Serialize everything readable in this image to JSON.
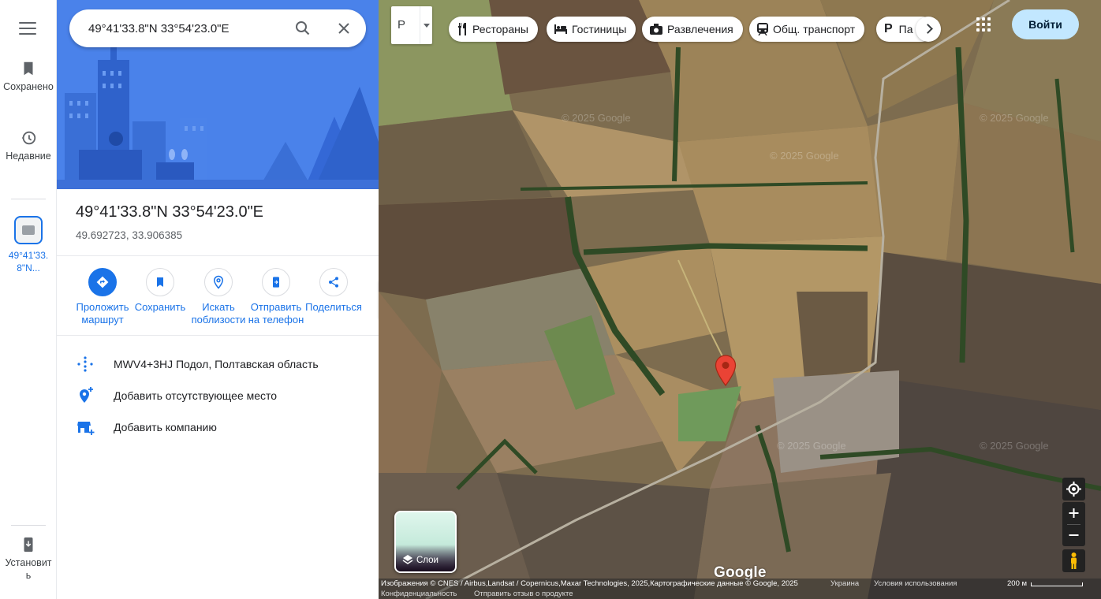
{
  "rail": {
    "items": [
      {
        "label": "Сохранено",
        "icon": "bookmark-icon"
      },
      {
        "label": "Недавние",
        "icon": "history-icon"
      },
      {
        "label": "49°41'33.8\"N..."
      },
      {
        "label": "Установить",
        "icon": "phone-install-icon"
      }
    ]
  },
  "search": {
    "value": "49°41'33.8\"N 33°54'23.0\"E"
  },
  "place": {
    "title": "49°41'33.8\"N 33°54'23.0\"E",
    "coords": "49.692723, 33.906385"
  },
  "actions": [
    {
      "label": "Проложить маршрут",
      "icon": "directions-icon"
    },
    {
      "label": "Сохранить",
      "icon": "bookmark-icon"
    },
    {
      "label": "Искать поблизости",
      "icon": "nearby-search-icon"
    },
    {
      "label": "Отправить на телефон",
      "icon": "send-to-phone-icon"
    },
    {
      "label": "Поделиться",
      "icon": "share-icon"
    }
  ],
  "info": [
    {
      "text": "MWV4+3HJ Подол, Полтавская область",
      "icon": "plus-code-icon"
    },
    {
      "text": "Добавить отсутствующее место",
      "icon": "add-place-icon"
    },
    {
      "text": "Добавить компанию",
      "icon": "add-business-icon"
    }
  ],
  "map": {
    "maptype_label": "Р",
    "chips": [
      {
        "label": "Рестораны",
        "icon": "restaurant-icon"
      },
      {
        "label": "Гостиницы",
        "icon": "hotel-icon"
      },
      {
        "label": "Развлечения",
        "icon": "camera-icon"
      },
      {
        "label": "Общ. транспорт",
        "icon": "transit-icon"
      },
      {
        "label": "Па",
        "icon": "parking-icon"
      }
    ],
    "signin_label": "Войти",
    "layers_label": "Слои",
    "watermark": "© 2025 Google",
    "logo": "Google",
    "footer": {
      "attribution": "Изображения © CNES / Airbus,Landsat / Copernicus,Maxar Technologies, 2025,Картографические данные © Google, 2025",
      "country": "Украина",
      "terms": "Условия использования",
      "privacy": "Конфиденциальность",
      "feedback": "Отправить отзыв о продукте",
      "scale": "200 м"
    }
  },
  "colors": {
    "accent": "#1a73e8",
    "pin": "#ea4335",
    "signin_bg": "#c2e7ff"
  }
}
